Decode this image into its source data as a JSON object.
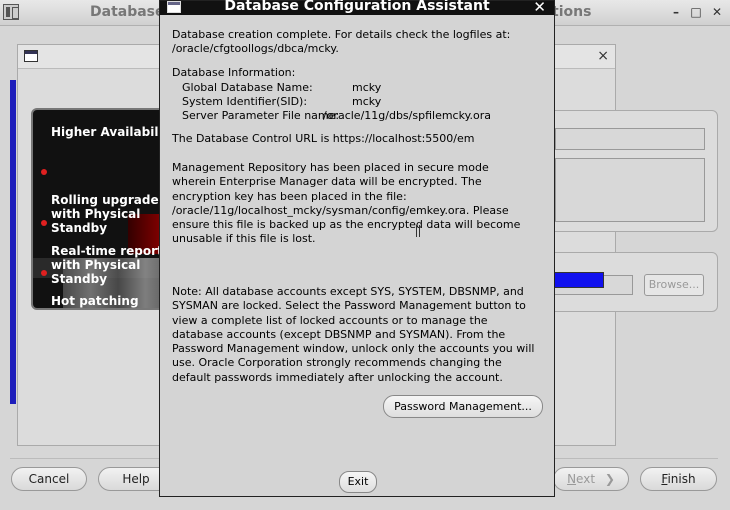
{
  "background_window": {
    "title_left": "Database",
    "title_right": "tions",
    "controls": {
      "minimize": "–",
      "maximize": "□",
      "close": "✕"
    },
    "inner_dialog_close": "×",
    "promo": {
      "title": "Higher Availability",
      "items": [
        "Rolling upgrades\nwith Physical\nStandby",
        "Real-time reporti\nwith Physical\nStandby",
        "Hot patching"
      ]
    },
    "browse_label": "Browse...",
    "buttons": {
      "cancel": "Cancel",
      "help": "Help",
      "next_letter": "N",
      "next_rest": "ext",
      "finish_letter": "F",
      "finish_rest": "inish"
    },
    "accent_color": "#1010ee"
  },
  "dialog": {
    "title": "Database Configuration Assistant",
    "close": "✕",
    "complete_line1": "Database creation complete. For details check the logfiles at:",
    "complete_line2": " /oracle/cfgtoollogs/dbca/mcky.",
    "info_header": "Database Information:",
    "info": [
      {
        "label": "Global Database Name:",
        "value": "mcky"
      },
      {
        "label": "System Identifier(SID):",
        "value": "mcky"
      },
      {
        "label": "Server Parameter File name:",
        "value": "/oracle/11g/dbs/spfilemcky.ora"
      }
    ],
    "control_url": "The Database Control URL is https://localhost:5500/em",
    "repo_text": "Management Repository has been placed in secure mode\nwherein Enterprise Manager data will be encrypted.  The\nencryption key has been placed in the file:\n/oracle/11g/localhost_mcky/sysman/config/emkey.ora.   Please\nensure this file is backed up as the encrypted data will become\nunusable if this file is lost.",
    "note_text": "Note: All database accounts except SYS, SYSTEM, DBSNMP, and\nSYSMAN are locked. Select the Password Management button to\nview a complete list of locked accounts or to manage the\ndatabase accounts (except DBSNMP and SYSMAN). From the\nPassword Management window, unlock only the accounts you will\nuse. Oracle Corporation strongly recommends changing the\ndefault passwords immediately after unlocking the account.",
    "password_button": "Password Management...",
    "exit_button": "Exit"
  }
}
